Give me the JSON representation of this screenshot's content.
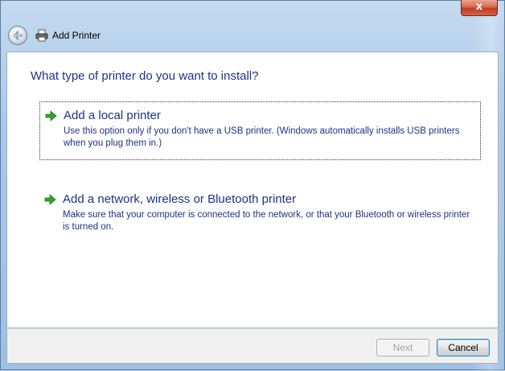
{
  "window": {
    "title": "Add Printer",
    "close_label": "x"
  },
  "content": {
    "heading": "What type of printer do you want to install?",
    "options": [
      {
        "label": "Add a local printer",
        "description": "Use this option only if you don't have a USB printer. (Windows automatically installs USB printers when you plug them in.)"
      },
      {
        "label": "Add a network, wireless or Bluetooth printer",
        "description": "Make sure that your computer is connected to the network, or that your Bluetooth or wireless printer is turned on."
      }
    ]
  },
  "buttons": {
    "next": "Next",
    "cancel": "Cancel"
  },
  "icons": {
    "back": "back-arrow-icon",
    "printer": "printer-icon",
    "option_arrow": "green-arrow-icon"
  },
  "colors": {
    "heading": "#1e3287",
    "arrow": "#2fa52f",
    "close": "#c23b1f"
  }
}
